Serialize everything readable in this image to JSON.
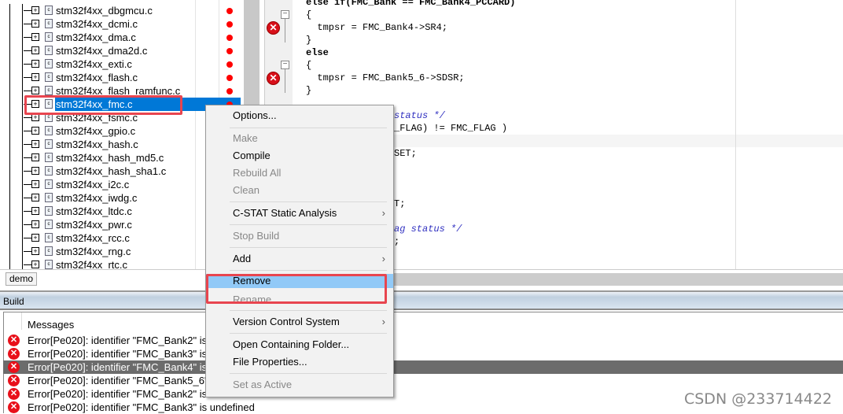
{
  "tree": {
    "files": [
      {
        "name": "stm32f4xx_dbgmcu.c",
        "error": true
      },
      {
        "name": "stm32f4xx_dcmi.c",
        "error": true
      },
      {
        "name": "stm32f4xx_dma.c",
        "error": true
      },
      {
        "name": "stm32f4xx_dma2d.c",
        "error": true
      },
      {
        "name": "stm32f4xx_exti.c",
        "error": true
      },
      {
        "name": "stm32f4xx_flash.c",
        "error": true
      },
      {
        "name": "stm32f4xx_flash_ramfunc.c",
        "error": true
      },
      {
        "name": "stm32f4xx_fmc.c",
        "error": true,
        "selected": true
      },
      {
        "name": "stm32f4xx_fsmc.c"
      },
      {
        "name": "stm32f4xx_gpio.c"
      },
      {
        "name": "stm32f4xx_hash.c"
      },
      {
        "name": "stm32f4xx_hash_md5.c"
      },
      {
        "name": "stm32f4xx_hash_sha1.c"
      },
      {
        "name": "stm32f4xx_i2c.c"
      },
      {
        "name": "stm32f4xx_iwdg.c"
      },
      {
        "name": "stm32f4xx_ltdc.c"
      },
      {
        "name": "stm32f4xx_pwr.c"
      },
      {
        "name": "stm32f4xx_rcc.c"
      },
      {
        "name": "stm32f4xx_rng.c"
      },
      {
        "name": "stm32f4xx_rtc.c"
      }
    ],
    "workspace_tab": "demo"
  },
  "editor": {
    "lines": [
      "else if(FMC_Bank == FMC_Bank4_PCCARD)",
      "{",
      "  tmpsr = FMC_Bank4->SR4;",
      "}",
      "else",
      "{",
      "  tmpsr = FMC_Bank5_6->SDSR;",
      "}"
    ],
    "fragments": [
      "status */",
      "_FLAG) != FMC_FLAG )",
      "SET;",
      "T;",
      "ag status */",
      ";"
    ]
  },
  "build": {
    "title": "Build",
    "column_header": "Messages",
    "messages": [
      "Error[Pe020]: identifier \"FMC_Bank2\" is undefined",
      "Error[Pe020]: identifier \"FMC_Bank3\" is undefined",
      "Error[Pe020]: identifier \"FMC_Bank4\" is undefined",
      "Error[Pe020]: identifier \"FMC_Bank5_6\" is undefined",
      "Error[Pe020]: identifier \"FMC_Bank2\" is undefined",
      "Error[Pe020]: identifier \"FMC_Bank3\" is undefined"
    ]
  },
  "context_menu": {
    "items": [
      {
        "label": "Options..."
      },
      {
        "label": "Make",
        "disabled": true
      },
      {
        "label": "Compile"
      },
      {
        "label": "Rebuild All",
        "disabled": true
      },
      {
        "label": "Clean",
        "disabled": true
      },
      {
        "label": "C-STAT Static Analysis",
        "submenu": true
      },
      {
        "label": "Stop Build",
        "disabled": true
      },
      {
        "label": "Add",
        "submenu": true
      },
      {
        "label": "Remove",
        "highlighted": true
      },
      {
        "label": "Rename...",
        "disabled": true
      },
      {
        "label": "Version Control System",
        "submenu": true
      },
      {
        "label": "Open Containing Folder..."
      },
      {
        "label": "File Properties..."
      },
      {
        "label": "Set as Active",
        "disabled": true
      }
    ]
  },
  "watermark": "CSDN @233714422",
  "colors": {
    "selection": "#0078d7",
    "menu_highlight": "#91c9f7",
    "annotation_box": "#e8454f",
    "error": "#e8101a"
  }
}
